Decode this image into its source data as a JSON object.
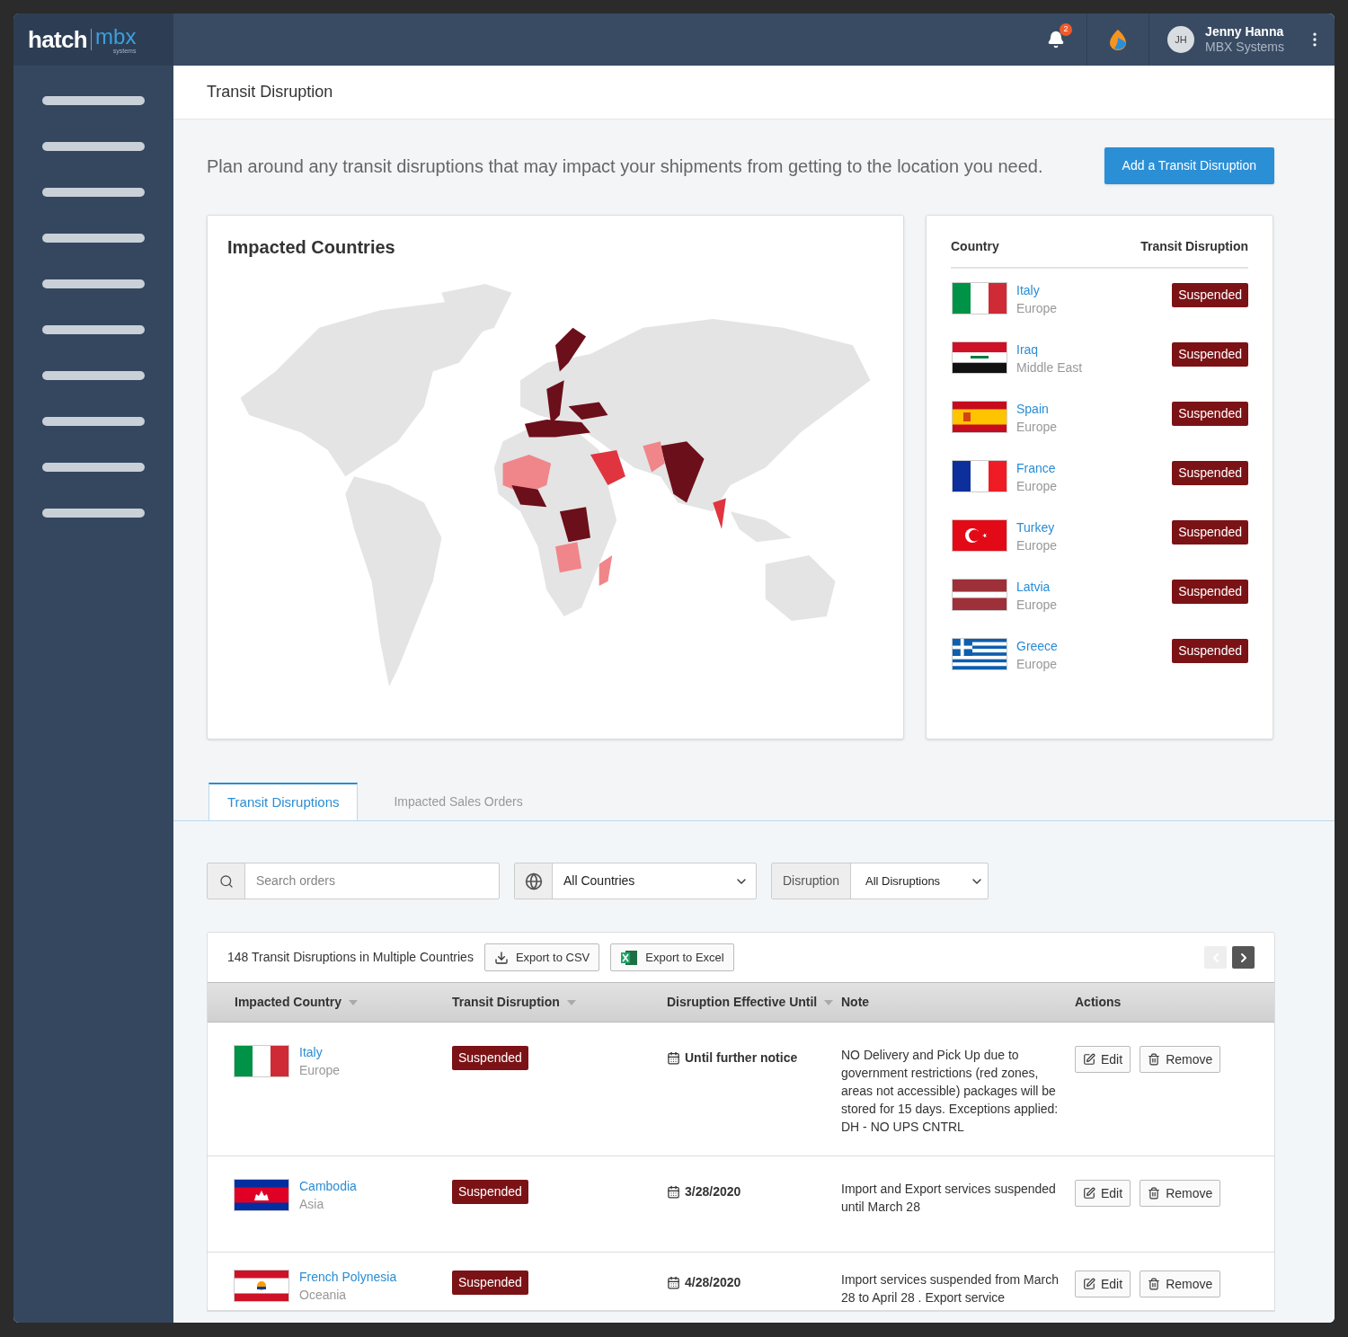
{
  "logo": {
    "primary": "hatch",
    "secondary": "mbx",
    "tagline": "systems"
  },
  "header": {
    "notification_count": "2",
    "user": {
      "initials": "JH",
      "name": "Jenny Hanna",
      "company": "MBX Systems"
    }
  },
  "page_title": "Transit Disruption",
  "intro": "Plan around any transit disruptions that may impact your shipments from getting to the location you need.",
  "add_button": "Add a Transit Disruption",
  "map_card": {
    "title": "Impacted Countries"
  },
  "country_list": {
    "columns": [
      "Country",
      "Transit Disruption"
    ],
    "rows": [
      {
        "kind": "italy",
        "country": "Italy",
        "region": "Europe",
        "status": "Suspended"
      },
      {
        "kind": "iraq",
        "country": "Iraq",
        "region": "Middle East",
        "status": "Suspended"
      },
      {
        "kind": "spain",
        "country": "Spain",
        "region": "Europe",
        "status": "Suspended"
      },
      {
        "kind": "france",
        "country": "France",
        "region": "Europe",
        "status": "Suspended"
      },
      {
        "kind": "turkey",
        "country": "Turkey",
        "region": "Europe",
        "status": "Suspended"
      },
      {
        "kind": "latvia",
        "country": "Latvia",
        "region": "Europe",
        "status": "Suspended"
      },
      {
        "kind": "greece",
        "country": "Greece",
        "region": "Europe",
        "status": "Suspended"
      }
    ]
  },
  "tabs": [
    {
      "label": "Transit Disruptions",
      "selected": true
    },
    {
      "label": "Impacted Sales Orders",
      "selected": false
    }
  ],
  "filters": {
    "search_placeholder": "Search orders",
    "country": "All Countries",
    "disruption_label": "Disruption",
    "disruption": "All Disruptions"
  },
  "results": {
    "summary": "148 Transit Disruptions in Multiple Countries",
    "export_csv": "Export to CSV",
    "export_excel": "Export to Excel",
    "pager": [
      {
        "kind": "prev",
        "disabled": true
      },
      {
        "kind": "next",
        "disabled": false
      }
    ]
  },
  "table": {
    "columns": [
      {
        "label": "Impacted Country",
        "sortable": true
      },
      {
        "label": "Transit Disruption",
        "sortable": true
      },
      {
        "label": "Disruption Effective Until",
        "sortable": true
      },
      {
        "label": "Note",
        "sortable": false
      },
      {
        "label": "Actions",
        "sortable": false
      }
    ],
    "rows": [
      {
        "kind": "italy",
        "country": "Italy",
        "region": "Europe",
        "status": "Suspended",
        "until": "Until further notice",
        "note": "NO Delivery and Pick Up due to government restrictions (red zones, areas not accessible) packages will be stored for 15 days. Exceptions applied: DH - NO UPS CNTRL",
        "actions": [
          "Edit",
          "Remove"
        ]
      },
      {
        "kind": "cambodia",
        "country": "Cambodia",
        "region": "Asia",
        "status": "Suspended",
        "until": "3/28/2020",
        "note": "Import and Export services suspended until March 28",
        "actions": [
          "Edit",
          "Remove"
        ]
      },
      {
        "kind": "french-polynesia",
        "country": "French Polynesia",
        "region": "Oceania",
        "status": "Suspended",
        "until": "4/28/2020",
        "note": "Import services suspended from March 28 to April 28 . Export service",
        "actions": [
          "Edit",
          "Remove"
        ]
      }
    ]
  }
}
